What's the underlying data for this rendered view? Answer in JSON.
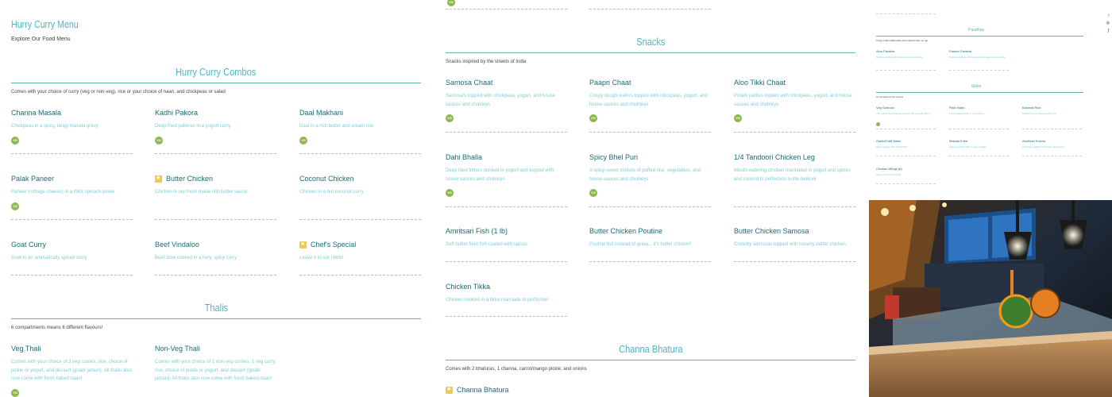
{
  "menu": {
    "title": "Hurry Curry Menu",
    "subtitle": "Explore Our Food Menu"
  },
  "vg_label": "VG",
  "combos": {
    "title": "Hurry Curry Combos",
    "desc": "Comes with your choice of curry (veg or non-veg), rice or your choice of naan, and chickpeas or salad",
    "items": [
      {
        "name": "Channa Masala",
        "desc": "Chickpeas in a spicy, tangy masala gravy"
      },
      {
        "name": "Kadhi Pakora",
        "desc": "Deep fried pakoras in a yogurt curry"
      },
      {
        "name": "Daal Makhani",
        "desc": "Daal in a rich butter and cream mix"
      },
      {
        "name": "Palak Paneer",
        "desc": "Paneer (cottage cheese) in a thick spinach puree"
      },
      {
        "name": "Butter Chicken",
        "desc": "Chicken in our fresh made rich butter sauce"
      },
      {
        "name": "Coconut Chicken",
        "desc": "Chicken in a hot coconut curry"
      },
      {
        "name": "Goat Curry",
        "desc": "Goat in an aromatically spiced curry"
      },
      {
        "name": "Beef Vindaloo",
        "desc": "Beef slow cooked in a fiery, spicy curry"
      },
      {
        "name": "Chef's Special",
        "desc": "Leave it to our chefs!"
      }
    ]
  },
  "thalis": {
    "title": "Thalis",
    "desc": "6 compartments means 6 different flavours!",
    "items": [
      {
        "name": "Veg Thali",
        "desc": "Comes with your choice of 3 veg curries, rice, choice of pickle or yogurt, and dessert (gulab jamun). All thalis also now come with fresh baked naan!"
      },
      {
        "name": "Non-Veg Thali",
        "desc": "Comes with your choice of 2 non-veg curries, 1 veg curry, rice, choice of pickle or yogurt, and dessert (gulab jamun). All thalis also now come with fresh baked naan!"
      }
    ]
  },
  "snacks": {
    "title": "Snacks",
    "desc": "Snacks inspired by the streets of India",
    "items": [
      {
        "name": "Samosa Chaat",
        "desc": "Samosa's topped with chickpeas, yogurt, and house sauces and chutneys"
      },
      {
        "name": "Paapri Chaat",
        "desc": "Crispy dough wafers topped with chickpeas, yogurt, and house sauces and chutneys"
      },
      {
        "name": "Aloo Tikki Chaat",
        "desc": "Potato patties topped with chickpeas, yogurt, and house sauces and chutneys"
      },
      {
        "name": "Dahi Bhalla",
        "desc": "Deep fried fritters dunked in yogurt and topped with house sauces and chutneys"
      },
      {
        "name": "Spicy Bhel Puri",
        "desc": "A spicy-sweet mixture of puffed rice, vegetables, and house sauces and chutneys"
      },
      {
        "name": "1/4 Tandoori Chicken Leg",
        "desc": "Mouth-watering chicken marinated in yogurt and spices and cooked to perfection in the tandoor"
      },
      {
        "name": "Amritsari Fish (1 lb)",
        "desc": "Soft butter fried fish coated with spices"
      },
      {
        "name": "Butter Chicken Poutine",
        "desc": "Poutine but instead of gravy... it's butter chicken!"
      },
      {
        "name": "Butter Chicken Samosa",
        "desc": "Crunchy samosas topped with creamy butter chicken"
      },
      {
        "name": "Chicken Tikka",
        "desc": "Chicken cooked in a tikka marinade to perfection"
      }
    ]
  },
  "channa": {
    "title": "Channa Bhatura",
    "desc": "Comes with 2 bhaturas, 1 channa, carrot/mango pickle, and onions",
    "items": [
      {
        "name": "Channa Bhatura"
      }
    ]
  },
  "mini": {
    "parathas": {
      "title": "Parathas",
      "desc": "Crispy Indian flatbreads with melted butter on top",
      "items": [
        {
          "name": "Aloo Paratha",
          "desc": "Paratha stuffed with a flavourful potato filling"
        },
        {
          "name": "Paneer Paratha",
          "desc": "Paratha stuffed with a flavourful cottage cheese filling"
        }
      ]
    },
    "sides": {
      "title": "Sides",
      "desc": "To compliment the curries",
      "items": [
        {
          "name": "Veg Samosa",
          "desc": "The classic fried triangle stuffed with a potato filling"
        },
        {
          "name": "Plain Naan",
          "desc": "Fresh baked bread in the tandoor"
        },
        {
          "name": "Basmati Rice",
          "desc": "Steaming hot basmati white rice"
        },
        {
          "name": "Garlic/Chilli Naan",
          "desc": "Naan topped with garlic/chilli"
        },
        {
          "name": "Masala Fries",
          "desc": "Seasoned fries with a spicy masala"
        },
        {
          "name": "Amritsari Kulcha",
          "desc": "Soft naan stuffed with potato and spices"
        },
        {
          "name": "Chicken Wings (6)",
          "desc": "Wings of chicken wings"
        }
      ]
    }
  },
  "social": [
    "tiktok-icon",
    "instagram-icon",
    "facebook-icon"
  ]
}
